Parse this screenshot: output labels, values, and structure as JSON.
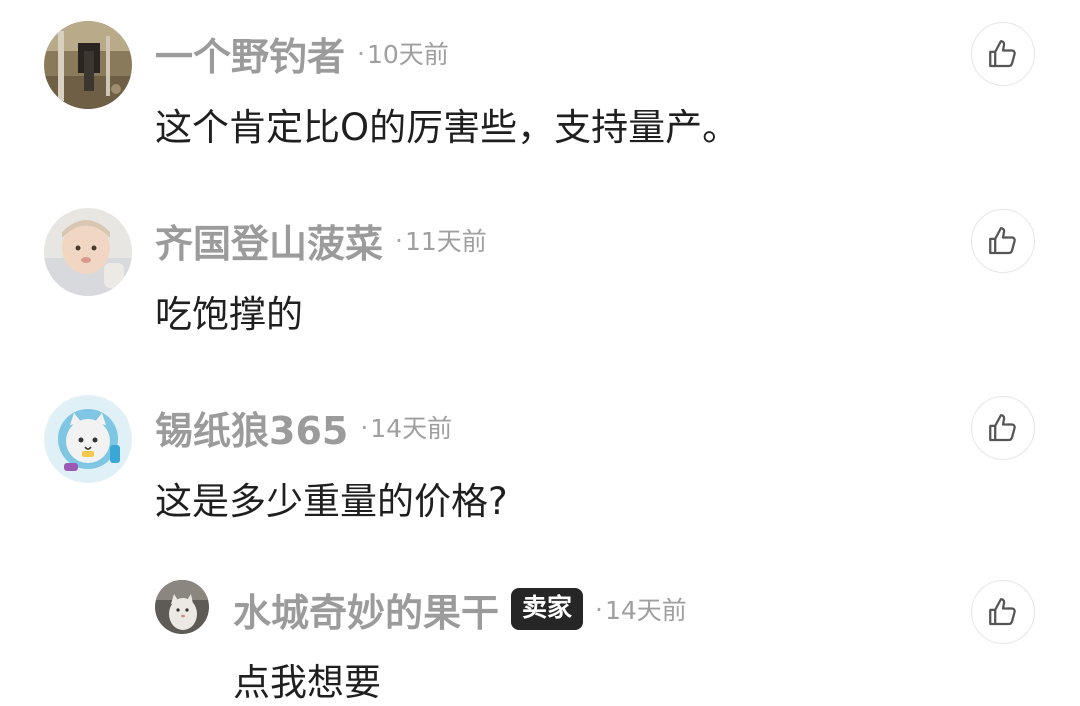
{
  "comments": [
    {
      "username": "一个野钓者",
      "separator": "·",
      "time": "10天前",
      "text": "这个肯定比O的厉害些，支持量产。",
      "like_icon": "thumbs-up-icon"
    },
    {
      "username": "齐国登山菠菜",
      "separator": "·",
      "time": "11天前",
      "text": "吃饱撑的",
      "like_icon": "thumbs-up-icon"
    },
    {
      "username": "锡纸狼365",
      "separator": "·",
      "time": "14天前",
      "text": "这是多少重量的价格?",
      "like_icon": "thumbs-up-icon"
    }
  ],
  "reply": {
    "username": "水城奇妙的果干",
    "badge": "卖家",
    "separator": "·",
    "time": "14天前",
    "text": "点我想要",
    "like_icon": "thumbs-up-icon"
  }
}
